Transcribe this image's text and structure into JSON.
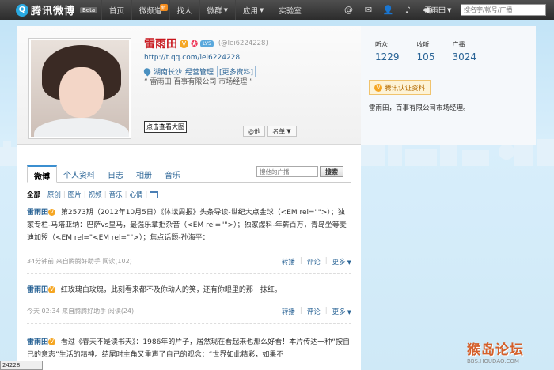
{
  "topbar": {
    "logo_text": "腾讯微博",
    "beta": "Beta",
    "nav": [
      {
        "label": "首页"
      },
      {
        "label": "微频道",
        "badge": "新"
      },
      {
        "label": "找人"
      },
      {
        "label": "微群",
        "dropdown": true
      },
      {
        "label": "应用",
        "dropdown": true
      },
      {
        "label": "实验室"
      }
    ],
    "tools": [
      "at-icon",
      "mail-icon",
      "person-icon",
      "bell-icon",
      "speaker-icon"
    ],
    "username": "雷雨田",
    "search_placeholder": "搜名字/帐号/广播"
  },
  "profile": {
    "name": "雷雨田",
    "level_badge": "LV5",
    "handle": "(@lei6224228)",
    "url": "http://t.qq.com/lei6224228",
    "location": "湖南长沙",
    "occupation": "经营管理",
    "more_info": "[更多资料]",
    "intro": "“ 雷雨田 百事有限公司 市场经理 ”",
    "avatar_tip": "点击查看大图",
    "at_button": "@他",
    "list_button": "名单"
  },
  "tabs": [
    {
      "label": "微博",
      "active": true
    },
    {
      "label": "个人资料"
    },
    {
      "label": "日志"
    },
    {
      "label": "相册"
    },
    {
      "label": "音乐"
    }
  ],
  "tab_search": {
    "placeholder": "搜他的广播",
    "button": "搜索"
  },
  "filters": [
    {
      "label": "全部",
      "active": true
    },
    {
      "label": "原创"
    },
    {
      "label": "图片"
    },
    {
      "label": "视频"
    },
    {
      "label": "音乐"
    },
    {
      "label": "心情"
    }
  ],
  "posts": [
    {
      "author": "雷雨田",
      "text": "第2573期（2012年10月5日）《体坛周报》头条导读-世纪大点金球（<EM rel=\"\">）；独家专栏-马塔亚纳：巴萨vs皇马，最强乐章拒杂音（<EM rel=\"\">）；独家爆料-年薪百万，青岛坐等麦迪加盟（<EM rel=\"<EM rel=\"\">）；焦点话题-孙海平：",
      "time": "34分钟前",
      "source": "来自腾腾好助手",
      "reads": "阅读(102)"
    },
    {
      "author": "雷雨田",
      "text": "红玫瑰白玫瑰，此刻看来都不及你动人的笑，还有你眼里的那一抹红。",
      "time": "今天 02:34",
      "source": "来自腾腾好助手",
      "reads": "阅读(24)"
    },
    {
      "author": "雷雨田",
      "text": "看过《春天不是读书天》：1986年的片子，居然现在看起来也那么好看！本片传达一种“按自己的意志”生活的精神。结尾时主角又重声了自己的观念：“世界如此精彩，如果不",
      "time": "",
      "source": "",
      "reads": ""
    }
  ],
  "post_actions": {
    "forward": "转播",
    "comment": "评论",
    "more": "更多"
  },
  "side": {
    "stats": [
      {
        "label": "听众",
        "value": "1229"
      },
      {
        "label": "收听",
        "value": "105"
      },
      {
        "label": "广播",
        "value": "3024"
      }
    ],
    "verify": "腾讯认证资料",
    "desc": "雷雨田，百事有限公司市场经理。"
  },
  "statusbar": "24228",
  "watermark": {
    "main": "猴岛论坛",
    "sub": "BBS.HOUDAO.COM"
  }
}
